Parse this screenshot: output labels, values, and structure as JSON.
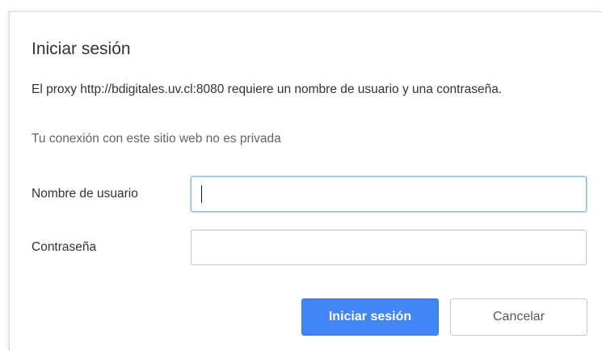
{
  "dialog": {
    "title": "Iniciar sesión",
    "message": "El proxy http://bdigitales.uv.cl:8080 requiere un nombre de usuario y una contraseña.",
    "privacy_note": "Tu conexión con este sitio web no es privada",
    "username": {
      "label": "Nombre de usuario",
      "value": ""
    },
    "password": {
      "label": "Contraseña",
      "value": ""
    },
    "buttons": {
      "submit": "Iniciar sesión",
      "cancel": "Cancelar"
    }
  },
  "colors": {
    "primary": "#4285f4",
    "focus_border": "#8fb4f2",
    "text": "#333333",
    "muted_text": "#646464"
  }
}
